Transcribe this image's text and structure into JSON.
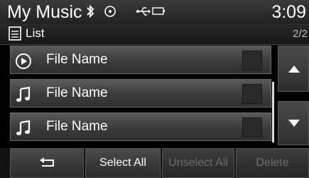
{
  "header": {
    "title": "My Music",
    "clock": "3:09",
    "icons": [
      "bluetooth-icon",
      "disc-icon",
      "usb-icon",
      "battery-icon"
    ]
  },
  "subheader": {
    "list_icon": "list-icon",
    "label": "List",
    "page": "2/2"
  },
  "list": {
    "items": [
      {
        "icon": "play-circle-icon",
        "label": "File Name",
        "checked": false
      },
      {
        "icon": "music-note-icon",
        "label": "File Name",
        "checked": false
      },
      {
        "icon": "music-note-icon",
        "label": "File Name",
        "checked": false
      }
    ]
  },
  "scroll": {
    "up_icon": "arrow-up-icon",
    "down_icon": "arrow-down-icon"
  },
  "bottom": {
    "back_icon": "back-arrow-icon",
    "select_all": "Select All",
    "unselect_all": "Unselect All",
    "delete": "Delete"
  }
}
